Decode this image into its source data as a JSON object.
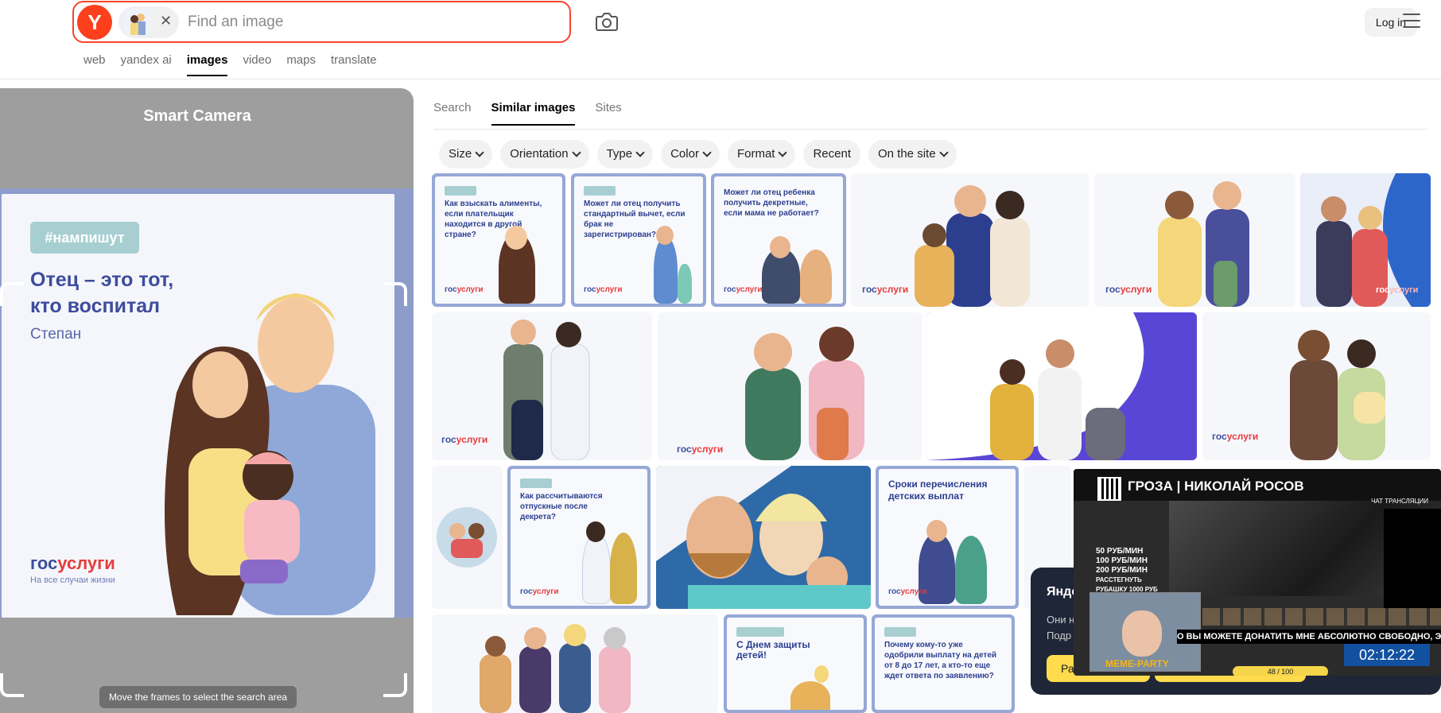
{
  "header": {
    "logo": "Y",
    "search_placeholder": "Find an image",
    "login_label": "Log in",
    "services": [
      {
        "label": "web"
      },
      {
        "label": "yandex ai"
      },
      {
        "label": "images",
        "active": true
      },
      {
        "label": "video"
      },
      {
        "label": "maps"
      },
      {
        "label": "translate"
      }
    ]
  },
  "smart_camera": {
    "title": "Smart Camera",
    "hint": "Move the frames to select the search area",
    "preview": {
      "tag": "#нампишут",
      "quote": "Отец – это тот, кто воспитал",
      "author": "Степан",
      "brand_gos": "гос",
      "brand_uslugi": "услуги",
      "brand_sub": "На все случаи жизни"
    }
  },
  "results": {
    "tabs": [
      {
        "label": "Search"
      },
      {
        "label": "Similar images",
        "active": true
      },
      {
        "label": "Sites"
      }
    ],
    "filters": [
      {
        "label": "Size",
        "dropdown": true
      },
      {
        "label": "Orientation",
        "dropdown": true
      },
      {
        "label": "Type",
        "dropdown": true
      },
      {
        "label": "Color",
        "dropdown": true
      },
      {
        "label": "Format",
        "dropdown": true
      },
      {
        "label": "Recent",
        "dropdown": false
      },
      {
        "label": "On the site",
        "dropdown": true
      }
    ],
    "tiles": {
      "t1": "Как взыскать алименты, если плательщик находится в другой стране?",
      "t2": "Может ли отец получить стандартный вычет, если брак не зарегистрирован?",
      "t3": "Может ли отец ребенка получить декретные, если мама не работает?",
      "t4": "Как рассчитываются отпускные после декрета?",
      "t5": "Сроки перечисления детских выплат",
      "t6": "С Днем защиты детей!",
      "t7": "Почему кому-то уже одобрили выплату на детей от 8 до 17 лет, а кто-то еще ждет ответа по заявлению?"
    }
  },
  "overlay": {
    "card_title": "Янде",
    "card_sub_1": "Они н",
    "card_sub_2": "Подр",
    "card_button": "Раз",
    "stream_title": "ГРОЗА | НИКОЛАЙ РОСОВ",
    "price_1": "50 РУБ/МИН",
    "price_2": "100 РУБ/МИН",
    "price_3": "200 РУБ/МИН",
    "price_4": "РАССТЕГНУТЬ РУБАШКУ 1000 РУБ",
    "badge": "ЧАТ ТРАНСЛЯЦИИ",
    "ticker": "О ВЫ МОЖЕТЕ ДОНАТИТЬ МНЕ АБСОЛЮТНО СВОБОДНО, ЭТ",
    "timer": "02:12:22",
    "meme": "MEME-PARTY",
    "counter": "48 / 100"
  },
  "colors": {
    "brand_red": "#fc3f1d",
    "search_border": "#f5442b",
    "gos_blue": "#3a4f9c",
    "frame_blue": "#96a8d6"
  }
}
